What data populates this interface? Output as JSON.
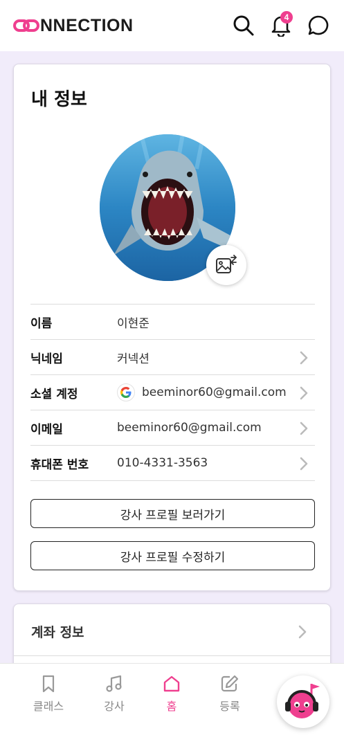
{
  "header": {
    "logo_text": "NNECTION",
    "notification_count": "4"
  },
  "profile": {
    "title": "내 정보",
    "rows": [
      {
        "label": "이름",
        "value": "이현준"
      },
      {
        "label": "닉네임",
        "value": "커넥션"
      },
      {
        "label": "소셜 계정",
        "value": "beeminor60@gmail.com"
      },
      {
        "label": "이메일",
        "value": "beeminor60@gmail.com"
      },
      {
        "label": "휴대폰 번호",
        "value": "010-4331-3563"
      }
    ],
    "view_instructor_profile": "강사 프로필 보러가기",
    "edit_instructor_profile": "강사 프로필 수정하기"
  },
  "account": {
    "title": "계좌 정보"
  },
  "bottom_nav": {
    "items": [
      {
        "label": "클래스",
        "icon": "bookmark-icon"
      },
      {
        "label": "강사",
        "icon": "music-note-icon"
      },
      {
        "label": "홈",
        "icon": "home-icon"
      },
      {
        "label": "등록",
        "icon": "edit-icon"
      }
    ],
    "active": "홈"
  },
  "colors": {
    "brand_pink": "#ef3f8f",
    "background": "#f1ecfa"
  }
}
